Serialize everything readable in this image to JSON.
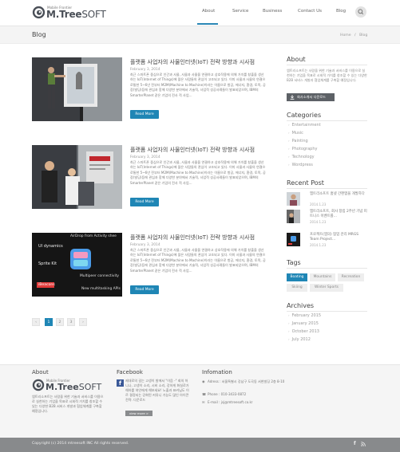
{
  "brand": {
    "sub": "Mobile Frontier",
    "main_bold": "M.Tree",
    "main_light": "SOFT"
  },
  "nav": [
    {
      "label": "About"
    },
    {
      "label": "Service"
    },
    {
      "label": "Business"
    },
    {
      "label": "Contact Us"
    },
    {
      "label": "Blog"
    }
  ],
  "page": {
    "title": "Blog",
    "breadcrumb_home": "Home",
    "breadcrumb_sep": "/",
    "breadcrumb_current": "Blog"
  },
  "posts": [
    {
      "title": "플랫폼 사업자의 사물인터넷(IoT) 전략 방향과 시사점",
      "date": "February 3, 2014",
      "excerpt": "최근 스마트폰 중심으로 인간과 사물, 사물과 사물을 연결하고 상호작용에 의해 가치를 창출을 생산하는 IoT(Internet of Things)에 많은 사람들의 관심이 고조되고 있다. 이미 사물과 사물의 연결으로통한 5~6년 전부터 M2M(Machine to Machine)이라는 이름으로 항공, 에너지, 환경, 토목, 공장(빌딩)등에 관심과 함께 다양한 분야에서 기술적, 사업적 성공사례들이 발표되었으며, IBM의 SmarterPlanet 같은 기업의 전사 적 사업...",
      "read_more": "Read More"
    },
    {
      "title": "플랫폼 사업자의 사물인터넷(IoT) 전략 방향과 시사점",
      "date": "February 3, 2014",
      "excerpt": "최근 스마트폰 중심으로 인간과 사물, 사물과 사물을 연결하고 상호작용에 의해 가치를 창출을 생산하는 IoT(Internet of Things)에 많은 사람들의 관심이 고조되고 있다. 이미 사물과 사물의 연결으로통한 5~6년 전부터 M2M(Machine to Machine)이라는 이름으로 항공, 에너지, 환경, 토목, 공장(빌딩)등에 관심과 함께 다양한 분야에서 기술적, 사업적 성공사례들이 발표되었으며, IBM의 SmarterPlanet 같은 기업의 전사 적 사업...",
      "read_more": "Read More"
    },
    {
      "title": "플랫폼 사업자의 사물인터넷(IoT) 전략 방향과 시사점",
      "date": "February 3, 2014",
      "excerpt": "최근 스마트폰 중심으로 인간과 사물, 사물과 사물을 연결하고 상호작용에 의해 가치를 창출을 생산하는 IoT(Internet of Things)에 많은 사람들의 관심이 고조되고 있다. 이미 사물과 사물의 연결으로통한 5~6년 전부터 M2M(Machine to Machine)이라는 이름으로 항공, 에너지, 환경, 토목, 공장(빌딩)등에 관심과 함께 다양한 분야에서 기술적, 사업적 성공사례들이 발표되었으며, IBM의 SmarterPlanet 같은 기업의 전사 적 사업...",
      "read_more": "Read More",
      "image_texts": [
        "AirDrop from Activity shee",
        "UI dynamics",
        "Sprite Kit",
        "iBeacons",
        "Multipeer connectivity",
        "New multitasking APIs"
      ]
    }
  ],
  "pagination": {
    "prev": "‹",
    "pages": [
      "1",
      "2",
      "3"
    ],
    "next": "›"
  },
  "sidebar": {
    "about": {
      "heading": "About",
      "text": "엠트리소프트는 사람을 위한 기술과 서비스를 이용으로 실천하는 기업을 목표로 시회적 가치를 창조할 수 있는 다양한 B2B 서비스 개발과 협업체계를 구축할 예정입니다.",
      "download_label": "회사소개서 다운로드"
    },
    "categories": {
      "heading": "Categories",
      "items": [
        "Entertainment",
        "Music",
        "Painting",
        "Photography",
        "Technology",
        "Wordpress"
      ]
    },
    "recent": {
      "heading": "Recent Post",
      "items": [
        {
          "title": "엠트리소프트 홈넷 간편앱을 개발하다",
          "date": "2014.1.23"
        },
        {
          "title": "엠트리소프트, 회사 창립 2주년 기념 피트니스 이벤트를...",
          "date": "2014.1.23"
        },
        {
          "title": "프로젝트(앱의) 협업 관리 MRGS Team Project...",
          "date": "2014.1.23"
        }
      ]
    },
    "tags": {
      "heading": "Tags",
      "items": [
        "Boating",
        "Mountains",
        "Recreation",
        "Skiing",
        "Winter Sports"
      ]
    },
    "archives": {
      "heading": "Archives",
      "items": [
        "February 2015",
        "January 2015",
        "October 2013",
        "July 2012"
      ]
    }
  },
  "footer": {
    "about": {
      "heading": "About",
      "text": "엠트리소프트는 사람을 위한 기술과 서비스를 이용으로 실천하는 기업을 목표로 시회적 가치를 창조할 수 있는 다양한 B2B 서비스 개발과 협업체계를 구축할 예정입니다."
    },
    "facebook": {
      "heading": "Facebook",
      "text": "제대로의 길는 고생이 발에서 \"이음 -\" 회의 허니나, 고생이 소리, 시비 소리, 강하게 화실로가해하를 혀인에게 해보세요! 노출과 표커님도 이르 결정되는 강화된 커뮤니 가능도 많인 아이콘 전략. 다운로드",
      "button": "view more >"
    },
    "info": {
      "heading": "Infomation",
      "address": "Adress : 서울특별시 강남구 도곡동 서현빌딩 2층 8-10",
      "phone": "Phone : 010-3433-0872",
      "email": "E-mail : jsj@mtreesoft.co.kr"
    },
    "copyright": "Copyright (c) 2014 mtreesoft INC All rights reserved."
  },
  "colors": {
    "accent": "#1f86b5",
    "dark": "#5d6166"
  }
}
